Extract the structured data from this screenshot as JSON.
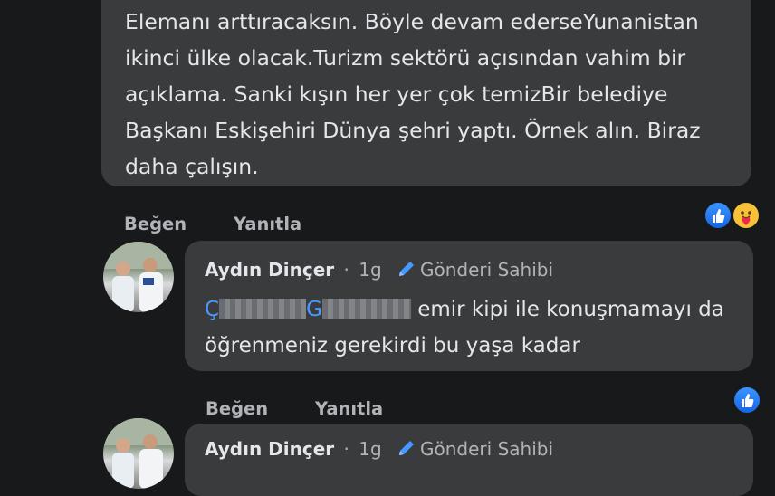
{
  "comment_main": {
    "text": "Elemanı arttıracaksın. Böyle devam ederseYunanistan ikinci ülke olacak.Turizm sektörü açısından vahim bir açıklama. Sanki kışın her yer çok temizBir belediye Başkanı Eskişehiri  Dünya şehri yaptı. Örnek alın. Biraz daha çalışın.",
    "like_label": "Beğen",
    "reply_label": "Yanıtla",
    "reactions": [
      "like-icon",
      "care-icon"
    ]
  },
  "reply_1": {
    "author": "Aydın Dinçer",
    "separator": "·",
    "time": "1g",
    "badge": "Gönderi Sahibi",
    "mention_initial_1": "Ç",
    "mention_initial_2": "G",
    "text": "emir kipi ile konuşmamayı da öğrenmeniz gerekirdi bu yaşa kadar",
    "like_label": "Beğen",
    "reply_label": "Yanıtla",
    "reactions": [
      "like-icon"
    ]
  },
  "reply_2": {
    "author": "Aydın Dinçer",
    "separator": "·",
    "time": "1g",
    "badge": "Gönderi Sahibi"
  },
  "colors": {
    "background": "#18191a",
    "bubble": "#3a3b3c",
    "mention": "#4599ff",
    "secondary_text": "#b0b3b8"
  }
}
